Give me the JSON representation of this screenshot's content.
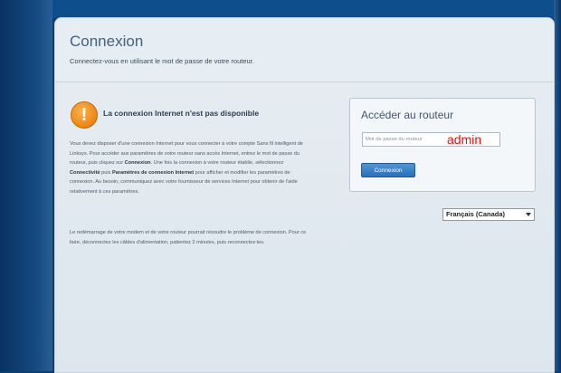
{
  "header": {
    "title": "Connexion",
    "subtitle": "Connectez-vous en utilisant le mot de passe de votre routeur."
  },
  "warning": {
    "icon": "exclamation-icon",
    "title": "La connexion Internet n'est pas disponible"
  },
  "message": {
    "p1_a": "Vous devez disposer d'une connexion Internet pour vous connecter à votre compte Sans fil intelligent de Linksys. Pour accéder aux paramètres de votre routeur sans accès Internet, entrez le mot de passe du routeur, puis cliquez sur ",
    "p1_b": "Connexion",
    "p1_c": ". Une fois la connexion à votre routeur établie, sélectionnez ",
    "p1_d": "Connectivité",
    "p1_e": " puis ",
    "p1_f": "Paramètres de connexion Internet",
    "p1_g": " pour afficher et modifier les paramètres de connexion. Au besoin, communiquez avec votre fournisseur de services Internet pour obtenir de l'aide relativement à ces paramètres.",
    "p2": "Le redémarrage de votre modem et de votre routeur pourrait résoudre le problème de connexion. Pour ce faire, déconnectez les câbles d'alimentation, patientez 2 minutes, puis reconnectez-les."
  },
  "login": {
    "title": "Accéder au routeur",
    "password_placeholder": "Mot de passe du routeur",
    "password_value": "admin",
    "button_label": "Connexion"
  },
  "language": {
    "selected": "Français (Canada)"
  },
  "colors": {
    "accent": "#2a6fb8",
    "warning": "#ee8616",
    "typed_text": "#e60f0f"
  }
}
